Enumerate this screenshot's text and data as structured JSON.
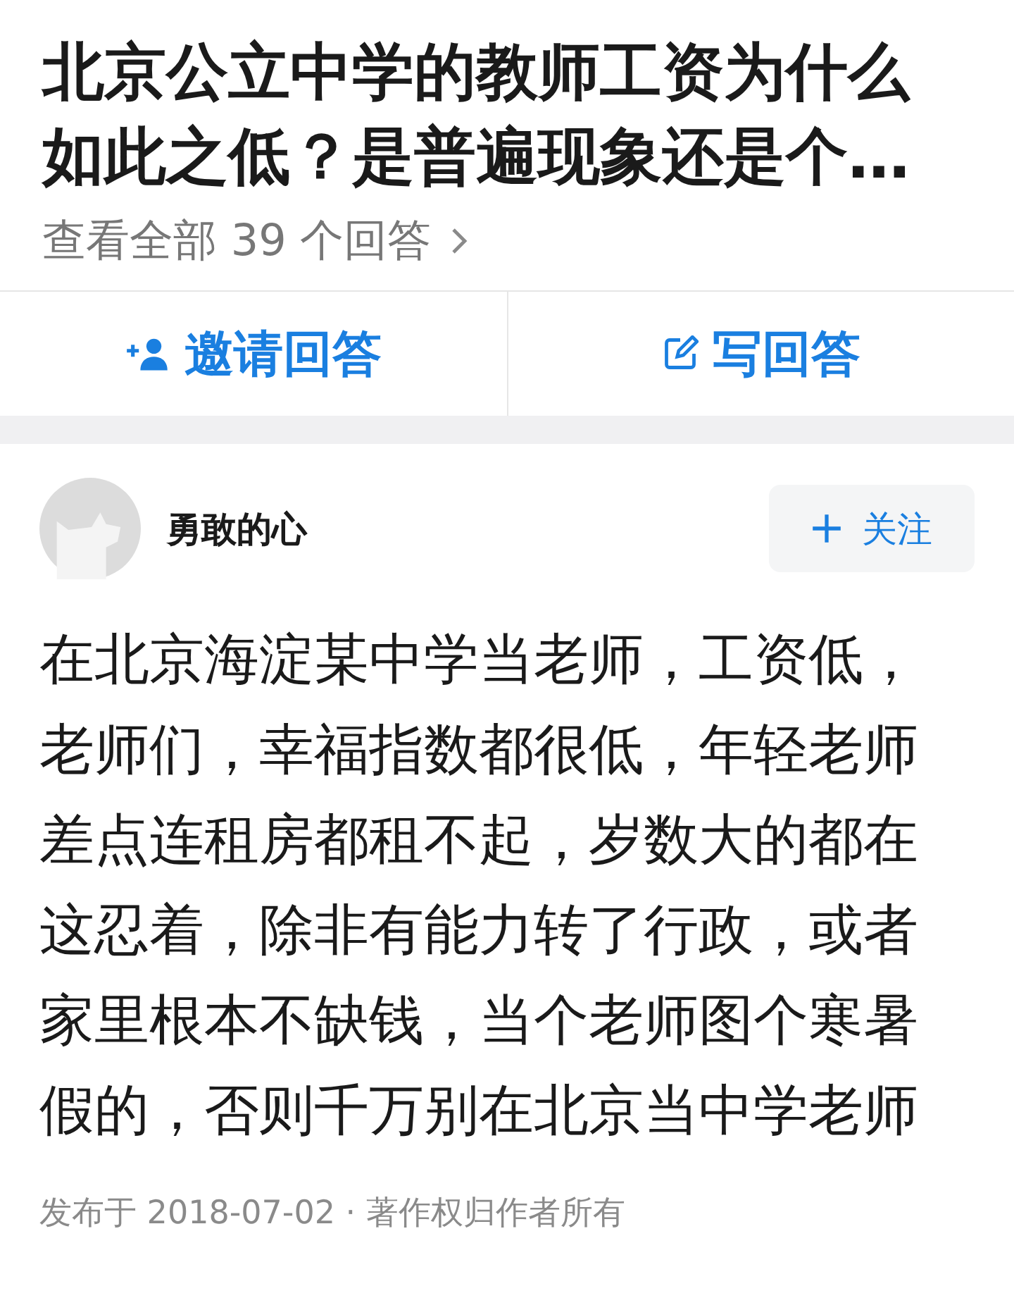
{
  "question": {
    "title": "北京公立中学的教师工资为什么如此之低？是普遍现象还是个…",
    "answers_link": "查看全部 39 个回答"
  },
  "actions": [
    {
      "kind": "invite",
      "label": "邀请回答"
    },
    {
      "kind": "write",
      "label": "写回答"
    }
  ],
  "answer": {
    "author": "勇敢的心",
    "follow_button": "关注",
    "body": "在北京海淀某中学当老师，工资低，老师们，幸福指数都很低，年轻老师差点连租房都租不起，岁数大的都在这忍着，除非有能力转了行政，或者家里根本不缺钱，当个老师图个寒暑假的，否则千万别在北京当中学老师",
    "footer": "发布于 2018-07-02 · 著作权归作者所有"
  }
}
